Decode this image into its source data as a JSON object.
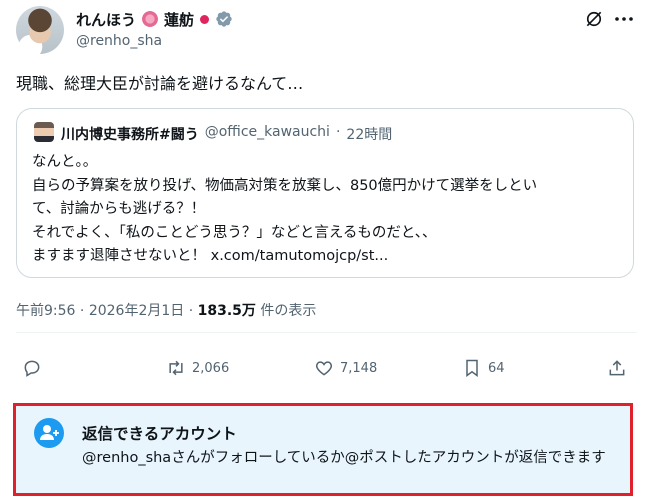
{
  "author": {
    "display_name": "れんほう",
    "display_name_suffix": "蓮舫",
    "handle": "@renho_sha"
  },
  "tweet": {
    "text": "現職、総理大臣が討論を避けるなんて…"
  },
  "quote": {
    "name": "川内博史事務所#闘う",
    "handle": "@office_kawauchi",
    "separator": "·",
    "time": "22時間",
    "lines": [
      "なんと。。",
      "自らの予算案を放り投げ、物価高対策を放棄し、850億円かけて選挙をしといて、討論からも逃げる？！",
      "それでよく、「私のことどう思う？」などと言えるものだと、、",
      "ますます退陣させないと！ x.com/tamutomojcp/st..."
    ]
  },
  "meta": {
    "time": "午前9:56",
    "dot": "·",
    "date": "2026年2月1日",
    "dot2": "·",
    "views": "183.5万",
    "views_label": "件の表示"
  },
  "actions": {
    "retweets": "2,066",
    "likes": "7,148",
    "bookmarks": "64"
  },
  "reply_restriction": {
    "title": "返信できるアカウント",
    "description": "@renho_shaさんがフォローしているか@ポストしたアカウントが返信できます"
  },
  "colors": {
    "accent": "#1d9bf0",
    "highlight_border": "#e0202a",
    "restriction_bg": "#e8f5fd",
    "muted": "#536471"
  },
  "icons": [
    "verified-icon",
    "grok-icon",
    "more-icon",
    "reply-icon",
    "retweet-icon",
    "like-icon",
    "bookmark-icon",
    "share-icon",
    "people-icon"
  ]
}
